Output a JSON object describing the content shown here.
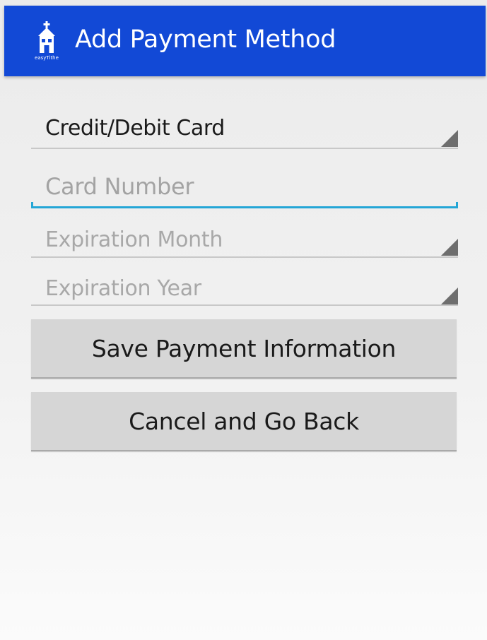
{
  "app_bar": {
    "title": "Add Payment Method",
    "logo_text": "easyTithe",
    "logo_icon": "church-icon",
    "background_color": "#1249d6"
  },
  "form": {
    "payment_type": {
      "selected": "Credit/Debit Card"
    },
    "card_number": {
      "value": "",
      "placeholder": "Card Number",
      "focused": true,
      "focus_color": "#24a6d6"
    },
    "expiration_month": {
      "placeholder": "Expiration Month"
    },
    "expiration_year": {
      "placeholder": "Expiration Year"
    }
  },
  "buttons": {
    "save_label": "Save Payment Information",
    "cancel_label": "Cancel and Go Back"
  }
}
